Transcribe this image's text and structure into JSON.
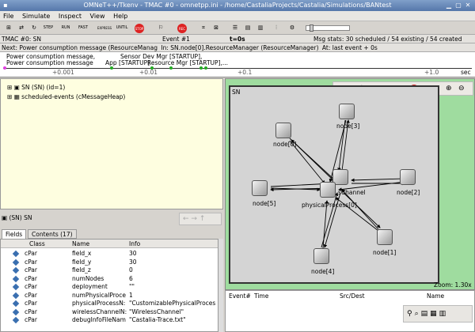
{
  "window": {
    "title": "OMNeT++/Tkenv - TMAC #0 - omnetpp.ini - /home/CastaliaProjects/Castalia/Simulations/BANtest"
  },
  "menu": [
    "File",
    "Simulate",
    "Inspect",
    "View",
    "Help"
  ],
  "toolbar": {
    "step": "STEP",
    "run": "RUN",
    "fast": "FAST",
    "express": "EXPRESS",
    "until": "UNTIL",
    "stop": "STOP",
    "rec": "REC"
  },
  "status": {
    "run": "TMAC #0: SN",
    "event": "Event #1",
    "time": "t=0s",
    "msgstats": "Msg stats: 30 scheduled / 54 existing / 54 created"
  },
  "next": {
    "text": "Next: Power consumption message (ResourceManag",
    "module": "In: SN.node[0].ResourceManager (ResourceManager)",
    "at": "At: last event + 0s"
  },
  "timeline": {
    "msg1": "Power consumption message,",
    "msg2": "Power consumption message",
    "msg3": "Sensor Dev Mgr [STARTUP],",
    "msg4": "App [STARTUP]",
    "msg5": "Resource Mgr [STARTUP],...",
    "ticks": [
      "+0.001",
      "+0.01",
      "+0.1",
      "+1.0"
    ],
    "unit": "sec"
  },
  "object_tree": [
    {
      "label": "SN (SN) (id=1)"
    },
    {
      "label": "scheduled-events (cMessageHeap)"
    }
  ],
  "inspector": {
    "title": "(SN) SN",
    "tabs": [
      "Fields",
      "Contents (17)"
    ],
    "columns": [
      "Class",
      "Name",
      "Info"
    ],
    "rows": [
      {
        "class": "cPar",
        "name": "field_x",
        "info": "30"
      },
      {
        "class": "cPar",
        "name": "field_y",
        "info": "30"
      },
      {
        "class": "cPar",
        "name": "field_z",
        "info": "0"
      },
      {
        "class": "cPar",
        "name": "numNodes",
        "info": "6"
      },
      {
        "class": "cPar",
        "name": "deployment",
        "info": "\"\""
      },
      {
        "class": "cPar",
        "name": "numPhysicalProce",
        "info": "1"
      },
      {
        "class": "cPar",
        "name": "physicalProcessN:",
        "info": "\"CustomizablePhysicalProces"
      },
      {
        "class": "cPar",
        "name": "wirelessChannelN:",
        "info": "\"WirelessChannel\""
      },
      {
        "class": "cPar",
        "name": "debugInfoFileNam",
        "info": "\"Castalia-Trace.txt\""
      }
    ]
  },
  "network": {
    "name": "SN",
    "zoom": "Zoom: 1.30x",
    "nodes": {
      "node0": "node[0]",
      "node1": "node[1]",
      "node2": "node[2]",
      "node3": "node[3]",
      "node4": "node[4]",
      "node5": "node[5]",
      "channel": "sChannel",
      "physproc": "physicalProcess[0]"
    }
  },
  "eventlog": {
    "columns": [
      "Event#",
      "Time",
      "Src/Dest",
      "Name"
    ]
  }
}
